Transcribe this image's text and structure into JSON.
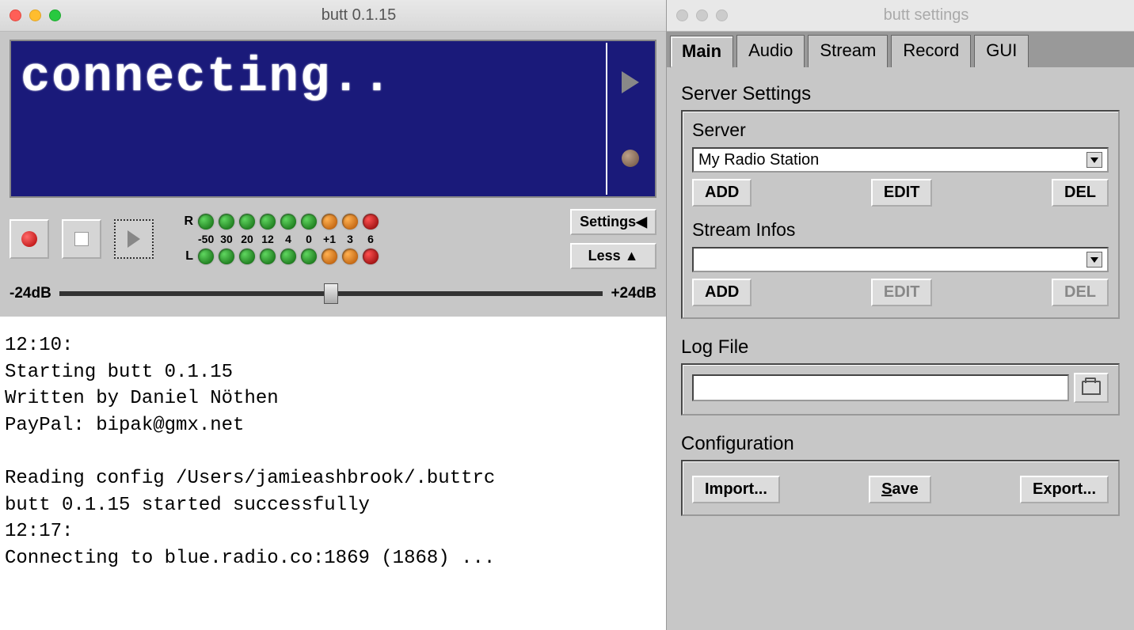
{
  "main_window": {
    "title": "butt 0.1.15",
    "lcd_text": "connecting..",
    "gain_min": "-24dB",
    "gain_max": "+24dB",
    "settings_btn": "Settings",
    "less_btn": "Less",
    "meter_scale": [
      "-50",
      "30",
      "20",
      "12",
      "4",
      "0",
      "+1",
      "3",
      "6"
    ],
    "log": "12:10:\nStarting butt 0.1.15\nWritten by Daniel Nöthen\nPayPal: bipak@gmx.net\n\nReading config /Users/jamieashbrook/.buttrc\nbutt 0.1.15 started successfully\n12:17:\nConnecting to blue.radio.co:1869 (1868) ..."
  },
  "settings_window": {
    "title": "butt settings",
    "tabs": [
      "Main",
      "Audio",
      "Stream",
      "Record",
      "GUI"
    ],
    "selected_tab": "Main",
    "server_settings": {
      "heading": "Server Settings",
      "server_label": "Server",
      "server_value": "My Radio Station",
      "add": "ADD",
      "edit": "EDIT",
      "del": "DEL",
      "stream_infos_label": "Stream Infos",
      "stream_infos_value": ""
    },
    "log_file": {
      "heading": "Log File",
      "value": ""
    },
    "configuration": {
      "heading": "Configuration",
      "import": "Import...",
      "save": "Save",
      "export": "Export..."
    }
  }
}
